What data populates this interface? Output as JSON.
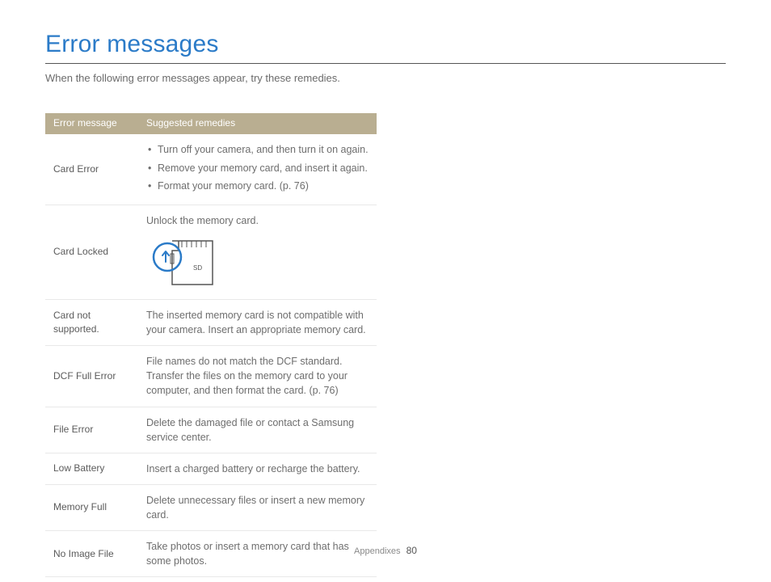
{
  "title": "Error messages",
  "intro": "When the following error messages appear, try these remedies.",
  "headers": {
    "col0": "Error message",
    "col1": "Suggested remedies"
  },
  "rows": {
    "cardError": {
      "label": "Card Error",
      "items": {
        "0": "Turn off your camera, and then turn it on again.",
        "1": "Remove your memory card, and insert it again.",
        "2": "Format your memory card. (p. 76)"
      }
    },
    "cardLocked": {
      "label": "Card Locked",
      "text": "Unlock the memory card.",
      "icon_label": "SD"
    },
    "cardNotSupported": {
      "label": "Card not supported.",
      "text": "The inserted memory card is not compatible with your camera. Insert an appropriate memory card."
    },
    "dcfFull": {
      "label": "DCF Full Error",
      "text": "File names do not match the DCF standard. Transfer the files on the memory card to your computer, and then format the card. (p. 76)"
    },
    "fileError": {
      "label": "File Error",
      "text": "Delete the damaged file or contact a Samsung service center."
    },
    "lowBattery": {
      "label": "Low Battery",
      "text": "Insert a charged battery or recharge the battery."
    },
    "memoryFull": {
      "label": "Memory Full",
      "text": "Delete unnecessary files or insert a new memory card."
    },
    "noImage": {
      "label": "No Image File",
      "text": "Take photos or insert a memory card that has some photos."
    }
  },
  "footer": {
    "section": "Appendixes",
    "page": "80"
  }
}
